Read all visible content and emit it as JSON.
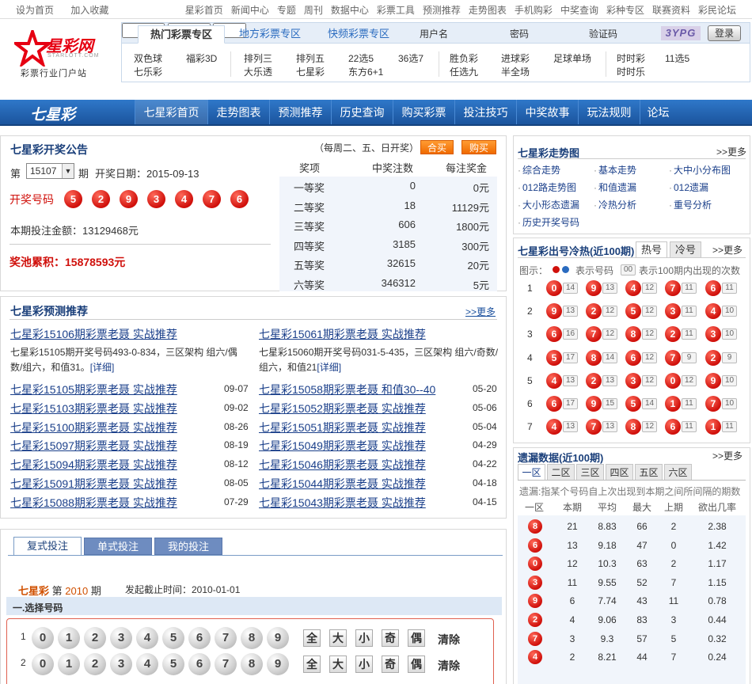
{
  "topbar": {
    "left": [
      "设为首页",
      "加入收藏"
    ],
    "right": [
      "星彩首页",
      "新闻中心",
      "专题",
      "周刊",
      "数据中心",
      "彩票工具",
      "预测推荐",
      "走势图表",
      "手机购彩",
      "中奖查询",
      "彩种专区",
      "联赛资料",
      "彩民论坛"
    ]
  },
  "logo": {
    "brand": "星彩网",
    "domain": "STARLOTT.COM",
    "slogan": "彩票行业门户站"
  },
  "header": {
    "tabs": [
      "热门彩票专区",
      "地方彩票专区",
      "快频彩票专区"
    ],
    "login": {
      "username_label": "用户名",
      "password_label": "密码",
      "captcha_label": "验证码",
      "captcha_text": "3YPG",
      "login_button": "登录"
    },
    "lotteries": [
      [
        "双色球",
        "福彩3D",
        "七乐彩"
      ],
      [
        "排列三",
        "排列五",
        "大乐透",
        "七星彩",
        "22选5",
        "36选7",
        "东方6+1"
      ],
      [
        "胜负彩",
        "进球彩",
        "任选九",
        "半全场",
        "足球单场"
      ],
      [
        "时时彩",
        "11选5",
        "时时乐"
      ]
    ]
  },
  "nav": {
    "title": "七星彩",
    "items": [
      "七星彩首页",
      "走势图表",
      "预测推荐",
      "历史查询",
      "购买彩票",
      "投注技巧",
      "中奖故事",
      "玩法规则",
      "论坛"
    ]
  },
  "draw": {
    "title": "七星彩开奖公告",
    "schedule": "（每周二、五、日开奖）",
    "buy_combo": "合买",
    "buy": "购买",
    "period_prefix": "第",
    "period": "15107",
    "period_suffix": "期",
    "date_label": "开奖日期：2015-09-13",
    "numbers_label": "开奖号码",
    "numbers": [
      "5",
      "2",
      "9",
      "3",
      "4",
      "7",
      "6"
    ],
    "sales": "本期投注金额：13129468元",
    "pool": "奖池累积：15878593元",
    "table_headers": [
      "奖项",
      "中奖注数",
      "每注奖金"
    ],
    "prizes": [
      {
        "name": "一等奖",
        "count": "0",
        "amount": "0元"
      },
      {
        "name": "二等奖",
        "count": "18",
        "amount": "11129元"
      },
      {
        "name": "三等奖",
        "count": "606",
        "amount": "1800元"
      },
      {
        "name": "四等奖",
        "count": "3185",
        "amount": "300元"
      },
      {
        "name": "五等奖",
        "count": "32615",
        "amount": "20元"
      },
      {
        "name": "六等奖",
        "count": "346312",
        "amount": "5元"
      }
    ]
  },
  "predict": {
    "title": "七星彩预测推荐",
    "more": ">>更多",
    "featured_left": {
      "link": "七星彩15106期彩票老聂 实战推荐",
      "desc": "七星彩15105期开奖号码493-0-834，三区架构 组六/偶数/组六，和值31。",
      "detail": "[详细]"
    },
    "featured_right": {
      "link": "七星彩15061期彩票老聂 实战推荐",
      "desc": "七星彩15060期开奖号码031-5-435，三区架构 组六/奇数/组六，和值21",
      "detail": "[详细]"
    },
    "left_list": [
      {
        "title": "七星彩15105期彩票老聂 实战推荐",
        "date": "09-07"
      },
      {
        "title": "七星彩15103期彩票老聂 实战推荐",
        "date": "09-02"
      },
      {
        "title": "七星彩15100期彩票老聂 实战推荐",
        "date": "08-26"
      },
      {
        "title": "七星彩15097期彩票老聂 实战推荐",
        "date": "08-19"
      },
      {
        "title": "七星彩15094期彩票老聂 实战推荐",
        "date": "08-12"
      },
      {
        "title": "七星彩15091期彩票老聂 实战推荐",
        "date": "08-05"
      },
      {
        "title": "七星彩15088期彩票老聂 实战推荐",
        "date": "07-29"
      }
    ],
    "right_list": [
      {
        "title": "七星彩15058期彩票老聂 和值30--40",
        "date": "05-20"
      },
      {
        "title": "七星彩15052期彩票老聂 实战推荐",
        "date": "05-06"
      },
      {
        "title": "七星彩15051期彩票老聂 实战推荐",
        "date": "05-04"
      },
      {
        "title": "七星彩15049期彩票老聂 实战推荐",
        "date": "04-29"
      },
      {
        "title": "七星彩15046期彩票老聂 实战推荐",
        "date": "04-22"
      },
      {
        "title": "七星彩15044期彩票老聂 实战推荐",
        "date": "04-18"
      },
      {
        "title": "七星彩15043期彩票老聂 实战推荐",
        "date": "04-15"
      }
    ]
  },
  "bet": {
    "tabs": [
      "复式投注",
      "单式投注",
      "我的投注"
    ],
    "game": "七星彩",
    "period_prefix": "第",
    "period": "2010",
    "period_suffix": "期",
    "deadline": "发起截止时间：2010-01-01",
    "step_title": "一.选择号码",
    "digits": [
      "0",
      "1",
      "2",
      "3",
      "4",
      "5",
      "6",
      "7",
      "8",
      "9"
    ],
    "quick": [
      "全",
      "大",
      "小",
      "奇",
      "偶"
    ],
    "clear": "清除",
    "rows": [
      "1",
      "2"
    ]
  },
  "trend": {
    "title": "七星彩走势图",
    "more": ">>更多",
    "links": [
      "综合走势",
      "基本走势",
      "大中小分布图",
      "012路走势图",
      "和值遗漏",
      "012遗漏",
      "大小形态遗漏",
      "冷热分析",
      "重号分析",
      "历史开奖号码"
    ]
  },
  "hotcold": {
    "title": "七星彩出号冷热(近100期)",
    "tabs": [
      "热号",
      "冷号"
    ],
    "more": ">>更多",
    "legend_label": "图示：",
    "legend_ball": "表示号码",
    "legend_count_sample": "00",
    "legend_count": "表示100期内出现的次数",
    "rows": [
      {
        "pos": "1",
        "cells": [
          [
            "0",
            "14"
          ],
          [
            "9",
            "13"
          ],
          [
            "4",
            "12"
          ],
          [
            "7",
            "11"
          ],
          [
            "6",
            "11"
          ]
        ]
      },
      {
        "pos": "2",
        "cells": [
          [
            "9",
            "13"
          ],
          [
            "2",
            "12"
          ],
          [
            "5",
            "12"
          ],
          [
            "3",
            "11"
          ],
          [
            "4",
            "10"
          ]
        ]
      },
      {
        "pos": "3",
        "cells": [
          [
            "6",
            "16"
          ],
          [
            "7",
            "12"
          ],
          [
            "8",
            "12"
          ],
          [
            "2",
            "11"
          ],
          [
            "3",
            "10"
          ]
        ]
      },
      {
        "pos": "4",
        "cells": [
          [
            "5",
            "17"
          ],
          [
            "8",
            "14"
          ],
          [
            "6",
            "12"
          ],
          [
            "7",
            "9"
          ],
          [
            "2",
            "9"
          ]
        ]
      },
      {
        "pos": "5",
        "cells": [
          [
            "4",
            "13"
          ],
          [
            "2",
            "13"
          ],
          [
            "3",
            "12"
          ],
          [
            "0",
            "12"
          ],
          [
            "9",
            "10"
          ]
        ]
      },
      {
        "pos": "6",
        "cells": [
          [
            "6",
            "17"
          ],
          [
            "9",
            "15"
          ],
          [
            "5",
            "14"
          ],
          [
            "1",
            "11"
          ],
          [
            "7",
            "10"
          ]
        ]
      },
      {
        "pos": "7",
        "cells": [
          [
            "4",
            "13"
          ],
          [
            "7",
            "13"
          ],
          [
            "8",
            "12"
          ],
          [
            "6",
            "11"
          ],
          [
            "1",
            "11"
          ]
        ]
      }
    ]
  },
  "missing": {
    "title": "遗漏数据(近100期)",
    "more": ">>更多",
    "tabs": [
      "一区",
      "二区",
      "三区",
      "四区",
      "五区",
      "六区"
    ],
    "note": "遗漏:指某个号码自上次出现到本期之间所间隔的期数",
    "headers": [
      "一区",
      "本期",
      "平均",
      "最大",
      "上期",
      "欲出几率"
    ],
    "rows": [
      [
        "8",
        "21",
        "8.83",
        "66",
        "2",
        "2.38"
      ],
      [
        "6",
        "13",
        "9.18",
        "47",
        "0",
        "1.42"
      ],
      [
        "0",
        "12",
        "10.3",
        "63",
        "2",
        "1.17"
      ],
      [
        "3",
        "11",
        "9.55",
        "52",
        "7",
        "1.15"
      ],
      [
        "9",
        "6",
        "7.74",
        "43",
        "11",
        "0.78"
      ],
      [
        "2",
        "4",
        "9.06",
        "83",
        "3",
        "0.44"
      ],
      [
        "7",
        "3",
        "9.3",
        "57",
        "5",
        "0.32"
      ],
      [
        "4",
        "2",
        "8.21",
        "44",
        "7",
        "0.24"
      ]
    ]
  }
}
